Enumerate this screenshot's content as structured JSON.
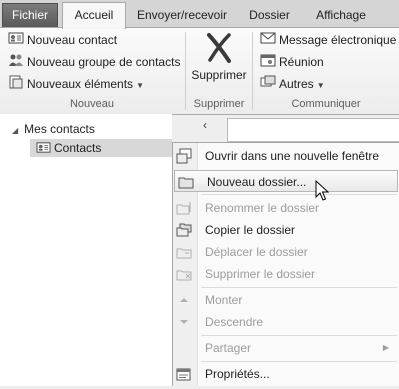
{
  "tabs": [
    "Fichier",
    "Accueil",
    "Envoyer/recevoir",
    "Dossier",
    "Affichage"
  ],
  "ribbon": {
    "nouveau": {
      "items": [
        "Nouveau contact",
        "Nouveau groupe de contacts",
        "Nouveaux éléments"
      ],
      "label": "Nouveau"
    },
    "supprimer": {
      "button": "Supprimer",
      "label": "Supprimer"
    },
    "communiquer": {
      "items": [
        "Message électronique",
        "Réunion",
        "Autres"
      ],
      "label": "Communiquer"
    }
  },
  "folder_pane": {
    "collapse_glyph": "‹",
    "root": "Mes contacts",
    "selected": "Contacts"
  },
  "context_menu": {
    "items": [
      {
        "label": "Ouvrir dans une nouvelle fenêtre",
        "enabled": true
      },
      {
        "label": "Nouveau dossier...",
        "enabled": true,
        "hover": true
      },
      {
        "label": "Renommer le dossier",
        "enabled": false
      },
      {
        "label": "Copier le dossier",
        "enabled": true
      },
      {
        "label": "Déplacer le dossier",
        "enabled": false
      },
      {
        "label": "Supprimer le dossier",
        "enabled": false
      },
      {
        "label": "Monter",
        "enabled": false
      },
      {
        "label": "Descendre",
        "enabled": false
      },
      {
        "label": "Partager",
        "enabled": false,
        "submenu": true
      },
      {
        "label": "Propriétés...",
        "enabled": true
      }
    ]
  },
  "colors": {
    "file_tab": "#5f5f5f",
    "ribbon_bg": "#f4f4f4",
    "menu_bg": "#fafafa",
    "disabled_text": "#9c9c9c"
  }
}
